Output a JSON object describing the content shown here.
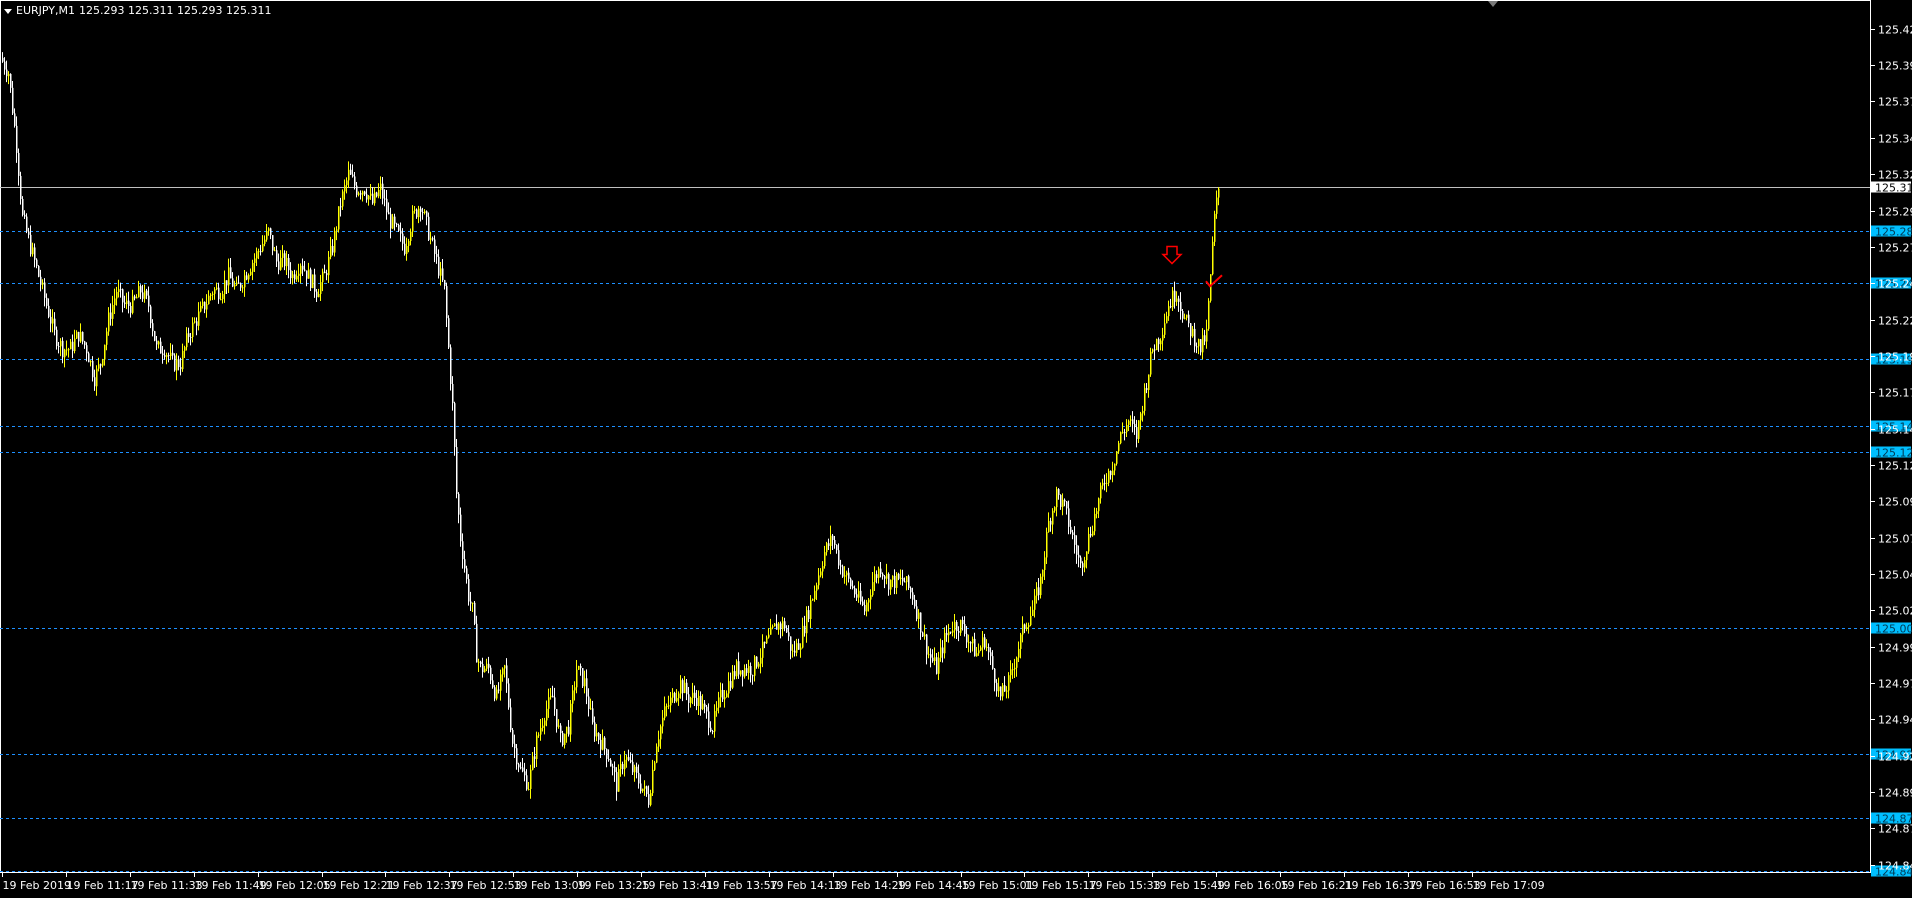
{
  "header": {
    "symbol": "EURJPY,M1",
    "prices": "125.293 125.311 125.293 125.311"
  },
  "colors": {
    "background": "#000000",
    "up_candle": "#ffff00",
    "down_candle": "#ffffff",
    "hline": "#1e90ff",
    "hline_label_bg": "#00bfff",
    "grid_text": "#ffffff",
    "arrow": "#ff0000"
  },
  "chart_data": {
    "type": "candlestick",
    "symbol": "EURJPY",
    "timeframe": "M1",
    "ylim": [
      124.84,
      125.435
    ],
    "y_ticks": [
      "125.420",
      "125.395",
      "125.370",
      "125.345",
      "125.320",
      "125.295",
      "125.270",
      "125.245",
      "125.220",
      "125.195",
      "125.170",
      "125.145",
      "125.120",
      "125.095",
      "125.070",
      "125.045",
      "125.020",
      "124.995",
      "124.970",
      "124.945",
      "124.920",
      "124.895",
      "124.870",
      "124.845"
    ],
    "x_ticks": [
      "19 Feb 2019",
      "19 Feb 11:17",
      "19 Feb 11:33",
      "19 Feb 11:49",
      "19 Feb 12:05",
      "19 Feb 12:21",
      "19 Feb 12:37",
      "19 Feb 12:53",
      "19 Feb 13:09",
      "19 Feb 13:25",
      "19 Feb 13:41",
      "19 Feb 13:57",
      "19 Feb 14:13",
      "19 Feb 14:29",
      "19 Feb 14:45",
      "19 Feb 15:01",
      "19 Feb 15:17",
      "19 Feb 15:33",
      "19 Feb 15:49",
      "19 Feb 16:05",
      "19 Feb 16:21",
      "19 Feb 16:37",
      "19 Feb 16:53",
      "19 Feb 17:09"
    ],
    "current_price": "125.311",
    "horizontal_levels": [
      "125.281",
      "125.245",
      "125.193",
      "125.147",
      "125.129",
      "125.008",
      "124.921",
      "124.877",
      "124.841"
    ],
    "close_path": [
      [
        0,
        125.4
      ],
      [
        8,
        125.39
      ],
      [
        16,
        125.34
      ],
      [
        22,
        125.29
      ],
      [
        30,
        125.27
      ],
      [
        38,
        125.25
      ],
      [
        46,
        125.23
      ],
      [
        54,
        125.21
      ],
      [
        62,
        125.2
      ],
      [
        70,
        125.2
      ],
      [
        78,
        125.21
      ],
      [
        86,
        125.2
      ],
      [
        94,
        125.18
      ],
      [
        100,
        125.19
      ],
      [
        108,
        125.22
      ],
      [
        116,
        125.24
      ],
      [
        124,
        125.23
      ],
      [
        132,
        125.23
      ],
      [
        140,
        125.24
      ],
      [
        148,
        125.23
      ],
      [
        156,
        125.2
      ],
      [
        164,
        125.2
      ],
      [
        172,
        125.19
      ],
      [
        180,
        125.19
      ],
      [
        188,
        125.21
      ],
      [
        196,
        125.22
      ],
      [
        204,
        125.23
      ],
      [
        212,
        125.24
      ],
      [
        220,
        125.24
      ],
      [
        228,
        125.25
      ],
      [
        236,
        125.24
      ],
      [
        244,
        125.25
      ],
      [
        252,
        125.26
      ],
      [
        260,
        125.27
      ],
      [
        268,
        125.28
      ],
      [
        276,
        125.26
      ],
      [
        284,
        125.26
      ],
      [
        292,
        125.25
      ],
      [
        300,
        125.26
      ],
      [
        308,
        125.25
      ],
      [
        316,
        125.24
      ],
      [
        324,
        125.25
      ],
      [
        332,
        125.27
      ],
      [
        340,
        125.3
      ],
      [
        348,
        125.32
      ],
      [
        356,
        125.31
      ],
      [
        364,
        125.31
      ],
      [
        372,
        125.3
      ],
      [
        380,
        125.31
      ],
      [
        388,
        125.29
      ],
      [
        396,
        125.28
      ],
      [
        404,
        125.27
      ],
      [
        412,
        125.29
      ],
      [
        420,
        125.3
      ],
      [
        428,
        125.28
      ],
      [
        436,
        125.26
      ],
      [
        444,
        125.24
      ],
      [
        452,
        125.16
      ],
      [
        456,
        125.1
      ],
      [
        460,
        125.07
      ],
      [
        464,
        125.05
      ],
      [
        468,
        125.03
      ],
      [
        472,
        125.02
      ],
      [
        476,
        124.99
      ],
      [
        480,
        124.98
      ],
      [
        488,
        124.98
      ],
      [
        496,
        124.96
      ],
      [
        504,
        124.98
      ],
      [
        512,
        124.93
      ],
      [
        520,
        124.91
      ],
      [
        528,
        124.9
      ],
      [
        536,
        124.93
      ],
      [
        544,
        124.95
      ],
      [
        552,
        124.96
      ],
      [
        560,
        124.93
      ],
      [
        568,
        124.94
      ],
      [
        576,
        124.98
      ],
      [
        584,
        124.97
      ],
      [
        592,
        124.94
      ],
      [
        600,
        124.93
      ],
      [
        608,
        124.92
      ],
      [
        616,
        124.9
      ],
      [
        624,
        124.92
      ],
      [
        632,
        124.91
      ],
      [
        640,
        124.9
      ],
      [
        648,
        124.89
      ],
      [
        656,
        124.93
      ],
      [
        664,
        124.95
      ],
      [
        672,
        124.96
      ],
      [
        680,
        124.97
      ],
      [
        688,
        124.96
      ],
      [
        696,
        124.96
      ],
      [
        704,
        124.95
      ],
      [
        712,
        124.94
      ],
      [
        720,
        124.96
      ],
      [
        728,
        124.97
      ],
      [
        736,
        124.98
      ],
      [
        744,
        124.98
      ],
      [
        752,
        124.98
      ],
      [
        760,
        124.99
      ],
      [
        768,
        125.0
      ],
      [
        776,
        125.01
      ],
      [
        784,
        125.01
      ],
      [
        792,
        124.99
      ],
      [
        800,
        125.0
      ],
      [
        808,
        125.02
      ],
      [
        816,
        125.04
      ],
      [
        824,
        125.06
      ],
      [
        832,
        125.07
      ],
      [
        840,
        125.05
      ],
      [
        848,
        125.04
      ],
      [
        856,
        125.03
      ],
      [
        864,
        125.02
      ],
      [
        872,
        125.04
      ],
      [
        880,
        125.05
      ],
      [
        888,
        125.04
      ],
      [
        896,
        125.04
      ],
      [
        904,
        125.04
      ],
      [
        912,
        125.03
      ],
      [
        920,
        125.01
      ],
      [
        928,
        124.99
      ],
      [
        936,
        124.98
      ],
      [
        944,
        125.0
      ],
      [
        952,
        125.01
      ],
      [
        960,
        125.01
      ],
      [
        968,
        125.0
      ],
      [
        976,
        124.99
      ],
      [
        984,
        125.0
      ],
      [
        992,
        124.98
      ],
      [
        1000,
        124.96
      ],
      [
        1008,
        124.97
      ],
      [
        1016,
        124.99
      ],
      [
        1024,
        125.01
      ],
      [
        1032,
        125.02
      ],
      [
        1040,
        125.04
      ],
      [
        1048,
        125.08
      ],
      [
        1056,
        125.1
      ],
      [
        1064,
        125.09
      ],
      [
        1072,
        125.07
      ],
      [
        1080,
        125.05
      ],
      [
        1088,
        125.07
      ],
      [
        1096,
        125.09
      ],
      [
        1104,
        125.11
      ],
      [
        1112,
        125.12
      ],
      [
        1120,
        125.14
      ],
      [
        1128,
        125.15
      ],
      [
        1136,
        125.14
      ],
      [
        1144,
        125.17
      ],
      [
        1152,
        125.2
      ],
      [
        1160,
        125.21
      ],
      [
        1168,
        125.23
      ],
      [
        1176,
        125.24
      ],
      [
        1184,
        125.22
      ],
      [
        1192,
        125.21
      ],
      [
        1200,
        125.2
      ],
      [
        1206,
        125.21
      ],
      [
        1210,
        125.25
      ],
      [
        1214,
        125.29
      ],
      [
        1218,
        125.31
      ]
    ],
    "annotations": [
      {
        "type": "down-arrow",
        "bar_x": 1172,
        "price": 125.262
      },
      {
        "type": "check-mark",
        "bar_x": 1212,
        "price": 125.245
      }
    ]
  }
}
